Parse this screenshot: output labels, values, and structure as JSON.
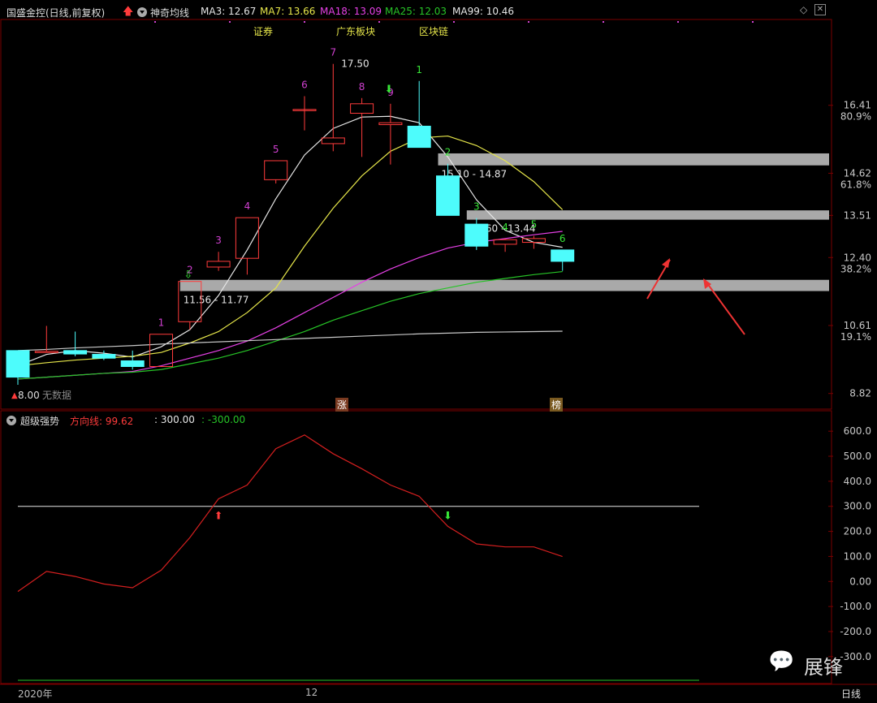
{
  "header": {
    "stock_name": "国盛金控(日线,前复权)",
    "indicator_name": "神奇均线",
    "ma3": "MA3: 12.67",
    "ma7": "MA7: 13.66",
    "ma18": "MA18: 13.09",
    "ma25": "MA25: 12.03",
    "ma99": "MA99: 10.46",
    "tags": [
      "证券",
      "广东板块",
      "区块链"
    ]
  },
  "sub_header": {
    "name": "超级强势",
    "direction_label": "方向线: 99.62",
    "level_high": ": 300.00",
    "level_low": ": -300.00"
  },
  "status_bar": {
    "year": "2020年",
    "month": "12",
    "period": "日线"
  },
  "overlay": {
    "no_data": "无数据",
    "price_8": "8.00"
  },
  "badges": {
    "zhang": "涨",
    "bang": "榜"
  },
  "watermark": "展锋",
  "colors": {
    "up": "#ff3b3b",
    "down": "#4dfcfc",
    "ma3": "#e6e6e6",
    "ma7": "#e6e64a",
    "ma18": "#e640e6",
    "ma25": "#27c427",
    "ma99": "#c8c8c8",
    "zone": "#a9a9a9",
    "label_magenta": "#d040d0",
    "label_green": "#37e637"
  },
  "chart_data": [
    {
      "type": "candlestick",
      "y_axis_ticks": [
        {
          "price": "16.41",
          "pct": "80.9%"
        },
        {
          "price": "14.62",
          "pct": "61.8%"
        },
        {
          "price": "13.51",
          "pct": ""
        },
        {
          "price": "12.40",
          "pct": "38.2%"
        },
        {
          "price": "10.61",
          "pct": "19.1%"
        },
        {
          "price": "8.82",
          "pct": ""
        }
      ],
      "ylim": [
        8.6,
        17.9
      ],
      "candles": [
        {
          "o": 9.95,
          "c": 9.25,
          "h": 9.95,
          "l": 9.05
        },
        {
          "o": 9.93,
          "c": 9.93,
          "h": 10.6,
          "l": 9.95
        },
        {
          "o": 9.95,
          "c": 9.86,
          "h": 10.45,
          "l": 9.8
        },
        {
          "o": 9.85,
          "c": 9.75,
          "h": 9.95,
          "l": 9.7
        },
        {
          "o": 9.68,
          "c": 9.53,
          "h": 9.95,
          "l": 9.45
        },
        {
          "o": 9.53,
          "c": 10.38,
          "h": 10.38,
          "l": 9.53
        },
        {
          "o": 10.71,
          "c": 11.77,
          "h": 11.77,
          "l": 10.5
        },
        {
          "o": 12.15,
          "c": 12.3,
          "h": 12.55,
          "l": 12.05
        },
        {
          "o": 12.38,
          "c": 13.45,
          "h": 13.45,
          "l": 11.95
        },
        {
          "o": 14.45,
          "c": 14.95,
          "h": 14.95,
          "l": 14.35
        },
        {
          "o": 16.3,
          "c": 16.3,
          "h": 16.65,
          "l": 15.75
        },
        {
          "o": 15.4,
          "c": 15.55,
          "h": 17.5,
          "l": 15.2
        },
        {
          "o": 16.2,
          "c": 16.45,
          "h": 16.6,
          "l": 15.05
        },
        {
          "o": 15.9,
          "c": 15.95,
          "h": 16.45,
          "l": 14.85
        },
        {
          "o": 15.86,
          "c": 15.3,
          "h": 17.05,
          "l": 15.3
        },
        {
          "o": 14.55,
          "c": 13.51,
          "h": 14.87,
          "l": 13.51
        },
        {
          "o": 13.28,
          "c": 12.7,
          "h": 13.44,
          "l": 12.6
        },
        {
          "o": 12.75,
          "c": 12.87,
          "h": 12.9,
          "l": 12.55
        },
        {
          "o": 12.8,
          "c": 12.9,
          "h": 12.97,
          "l": 12.63
        },
        {
          "o": 12.6,
          "c": 12.3,
          "h": 12.6,
          "l": 12.05
        }
      ],
      "ma_series": {
        "ma3": [
          9.55,
          9.85,
          9.95,
          9.88,
          9.78,
          10.05,
          10.5,
          11.4,
          12.6,
          13.95,
          15.1,
          15.8,
          16.1,
          16.12,
          15.95,
          15.05,
          13.92,
          13.12,
          12.8,
          12.67
        ],
        "ma7": [
          9.55,
          9.63,
          9.7,
          9.75,
          9.8,
          9.9,
          10.15,
          10.45,
          10.95,
          11.6,
          12.7,
          13.7,
          14.55,
          15.2,
          15.55,
          15.6,
          15.35,
          14.95,
          14.4,
          13.66
        ],
        "ma18": [
          9.2,
          9.25,
          9.3,
          9.35,
          9.4,
          9.55,
          9.75,
          9.95,
          10.2,
          10.55,
          10.95,
          11.35,
          11.75,
          12.1,
          12.4,
          12.65,
          12.8,
          12.9,
          13.0,
          13.09
        ],
        "ma25": [
          9.2,
          9.25,
          9.3,
          9.35,
          9.38,
          9.45,
          9.6,
          9.75,
          9.95,
          10.2,
          10.45,
          10.75,
          11.0,
          11.25,
          11.45,
          11.6,
          11.75,
          11.85,
          11.95,
          12.03
        ],
        "ma99": [
          9.95,
          9.98,
          10.02,
          10.05,
          10.08,
          10.12,
          10.15,
          10.18,
          10.21,
          10.24,
          10.27,
          10.3,
          10.33,
          10.36,
          10.39,
          10.41,
          10.43,
          10.44,
          10.45,
          10.46
        ]
      },
      "zones": [
        {
          "label": "11.56 - 11.77",
          "low": 11.56,
          "high": 11.77,
          "from": 6
        },
        {
          "label": "13.60 - 13.44",
          "low": 13.44,
          "high": 13.6,
          "from": 16
        },
        {
          "label": "15.10 - 14.87",
          "low": 14.87,
          "high": 15.1,
          "from": 15
        }
      ],
      "high_label": "17.50",
      "count_labels": [
        {
          "i": 5,
          "t": "1",
          "color": "magenta"
        },
        {
          "i": 6,
          "t": "2",
          "color": "magenta"
        },
        {
          "i": 7,
          "t": "3",
          "color": "magenta"
        },
        {
          "i": 8,
          "t": "4",
          "color": "magenta"
        },
        {
          "i": 9,
          "t": "5",
          "color": "magenta"
        },
        {
          "i": 10,
          "t": "6",
          "color": "magenta"
        },
        {
          "i": 11,
          "t": "7",
          "color": "magenta"
        },
        {
          "i": 12,
          "t": "8",
          "color": "magenta"
        },
        {
          "i": 13,
          "t": "9",
          "color": "magenta"
        },
        {
          "i": 14,
          "t": "1",
          "color": "green"
        },
        {
          "i": 15,
          "t": "2",
          "color": "green"
        },
        {
          "i": 16,
          "t": "3",
          "color": "green"
        },
        {
          "i": 17,
          "t": "4",
          "color": "green"
        },
        {
          "i": 18,
          "t": "5",
          "color": "green"
        },
        {
          "i": 19,
          "t": "6",
          "color": "green"
        }
      ]
    },
    {
      "type": "line",
      "name": "方向线",
      "y_axis_ticks": [
        "600.0",
        "500.0",
        "400.0",
        "300.0",
        "200.0",
        "100.0",
        "0.00",
        "-100.0",
        "-200.0",
        "-300.0"
      ],
      "ylim": [
        -320,
        620
      ],
      "values": [
        -40,
        40,
        20,
        -10,
        -25,
        45,
        175,
        330,
        385,
        530,
        585,
        510,
        450,
        385,
        340,
        220,
        150,
        138,
        138,
        99.62
      ],
      "levels": [
        300,
        -300
      ],
      "signals": [
        {
          "i": 7,
          "dir": "up"
        },
        {
          "i": 15,
          "dir": "down"
        }
      ]
    }
  ]
}
